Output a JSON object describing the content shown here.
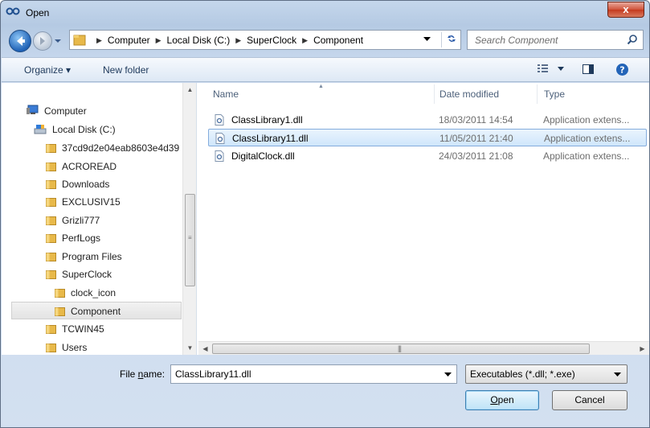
{
  "window": {
    "title": "Open",
    "close_label": "x"
  },
  "address": {
    "crumbs": [
      "Computer",
      "Local Disk (C:)",
      "SuperClock",
      "Component"
    ]
  },
  "search": {
    "placeholder": "Search Component"
  },
  "toolbar": {
    "organize_label": "Organize ▾",
    "new_folder_label": "New folder"
  },
  "nav_tree": {
    "computer": "Computer",
    "local_disk": "Local Disk (C:)",
    "folders": [
      "37cd9d2e04eab8603e4d39",
      "ACROREAD",
      "Downloads",
      "EXCLUSIV15",
      "Grizli777",
      "PerfLogs",
      "Program Files",
      "SuperClock"
    ],
    "subfolders": [
      "clock_icon",
      "Component"
    ],
    "after": [
      "TCWIN45",
      "Users"
    ]
  },
  "columns": {
    "name": "Name",
    "date": "Date modified",
    "type": "Type"
  },
  "files": [
    {
      "name": "ClassLibrary1.dll",
      "date": "18/03/2011 14:54",
      "type": "Application extens..."
    },
    {
      "name": "ClassLibrary11.dll",
      "date": "11/05/2011 21:40",
      "type": "Application extens..."
    },
    {
      "name": "DigitalClock.dll",
      "date": "24/03/2011 21:08",
      "type": "Application extens..."
    }
  ],
  "bottom": {
    "file_name_label_pre": "File ",
    "file_name_label_u": "n",
    "file_name_label_post": "ame:",
    "file_name_value": "ClassLibrary11.dll",
    "filter_value": "Executables (*.dll; *.exe)",
    "open_u": "O",
    "open_rest": "pen",
    "cancel_label": "Cancel"
  },
  "colors": {
    "selection": "#cfe6fb",
    "accent": "#1f62b6"
  },
  "icons": [
    "open-icon",
    "back-arrow-icon",
    "forward-arrow-icon",
    "folder-icon",
    "refresh-icon",
    "search-icon",
    "view-icon",
    "preview-pane-icon",
    "help-icon",
    "computer-icon",
    "drive-icon",
    "dll-file-icon",
    "chevron-down-icon"
  ]
}
